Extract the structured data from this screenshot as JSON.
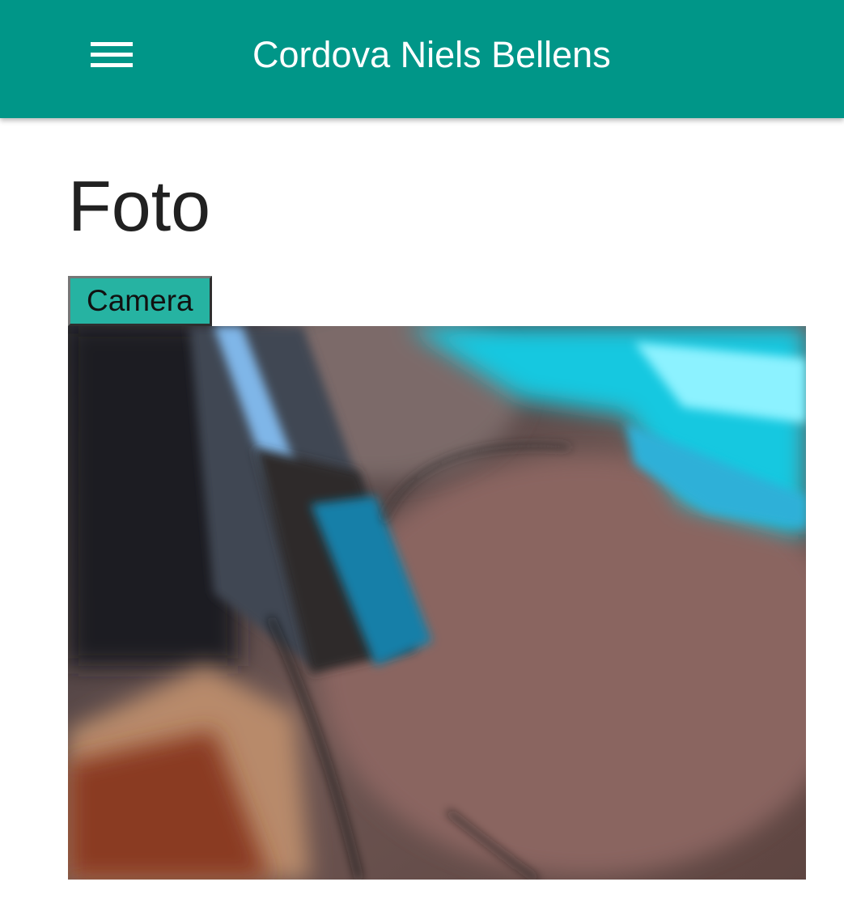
{
  "appbar": {
    "title": "Cordova Niels Bellens",
    "menu_icon": "hamburger-menu-icon",
    "color": "#009688"
  },
  "page": {
    "title": "Foto"
  },
  "camera": {
    "button_label": "Camera",
    "button_color": "#26b3a2"
  },
  "photo": {
    "description_icon": "captured-photo"
  }
}
